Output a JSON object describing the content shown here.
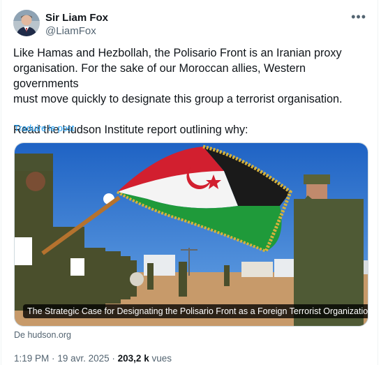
{
  "author": {
    "name": "Sir Liam Fox",
    "handle": "@LiamFox"
  },
  "more_icon": "more-horizontal-icon",
  "tweet": {
    "text": "Like Hamas and Hezbollah, the Polisario Front is an Iranian proxy\norganisation. For the sake of our Moroccan allies, Western governments\nmust move quickly to designate this group a terrorist organisation.\n\nRead the Hudson Institute report outlining why:",
    "translate_label": "Traduire le post"
  },
  "link_card": {
    "caption": "The Strategic Case for Designating the Polisario Front as a Foreign Terrorist Organization",
    "source": "De hudson.org"
  },
  "meta": {
    "time": "1:19 PM",
    "separator": "·",
    "date": "19 avr. 2025",
    "views_count": "203,2 k",
    "views_label": "vues"
  },
  "colors": {
    "link": "#1d9bf0",
    "secondary_text": "#536471"
  }
}
